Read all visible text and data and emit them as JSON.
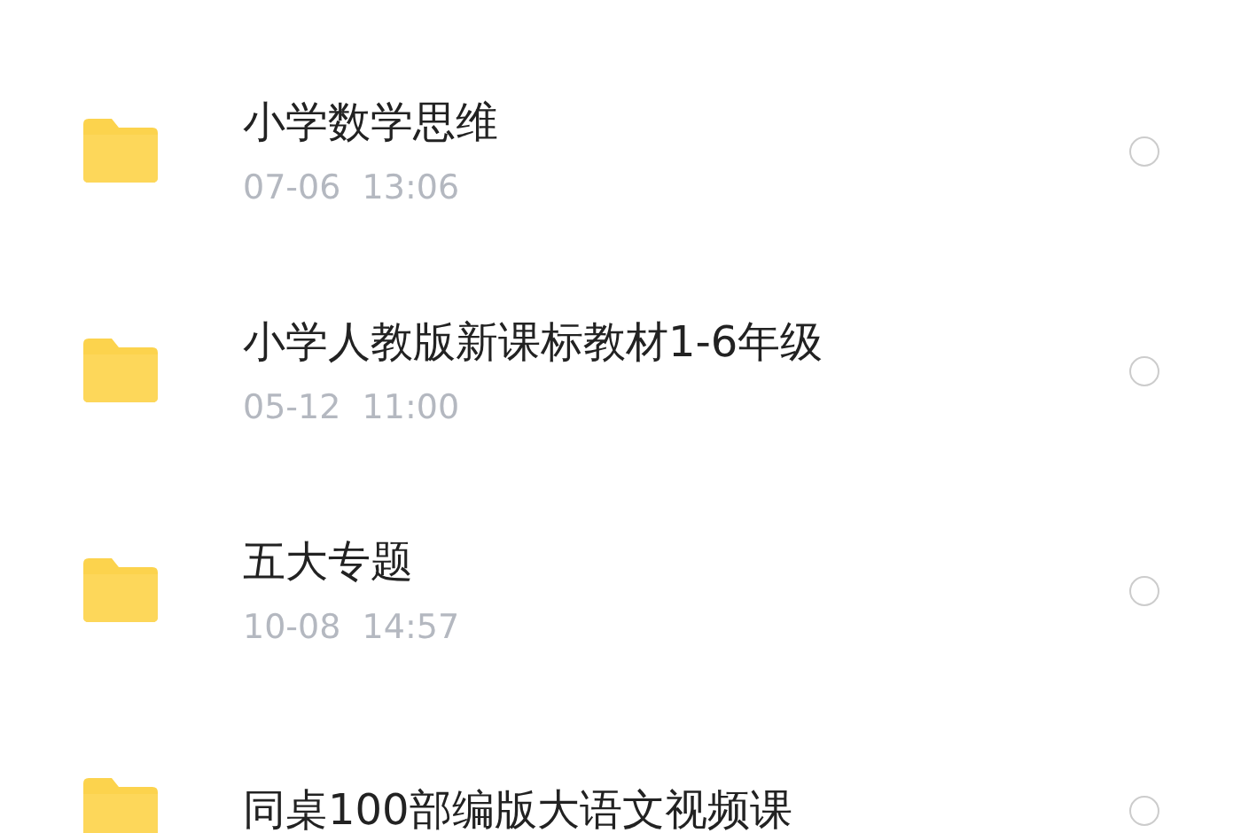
{
  "files": [
    {
      "name": "小学数学思维",
      "date": "07-06  13:06",
      "selected": false
    },
    {
      "name": "小学人教版新课标教材1-6年级",
      "date": "05-12  11:00",
      "selected": false
    },
    {
      "name": "五大专题",
      "date": "10-08  14:57",
      "selected": false
    },
    {
      "name": "同桌100部编版大语文视频课",
      "selected": false
    }
  ]
}
